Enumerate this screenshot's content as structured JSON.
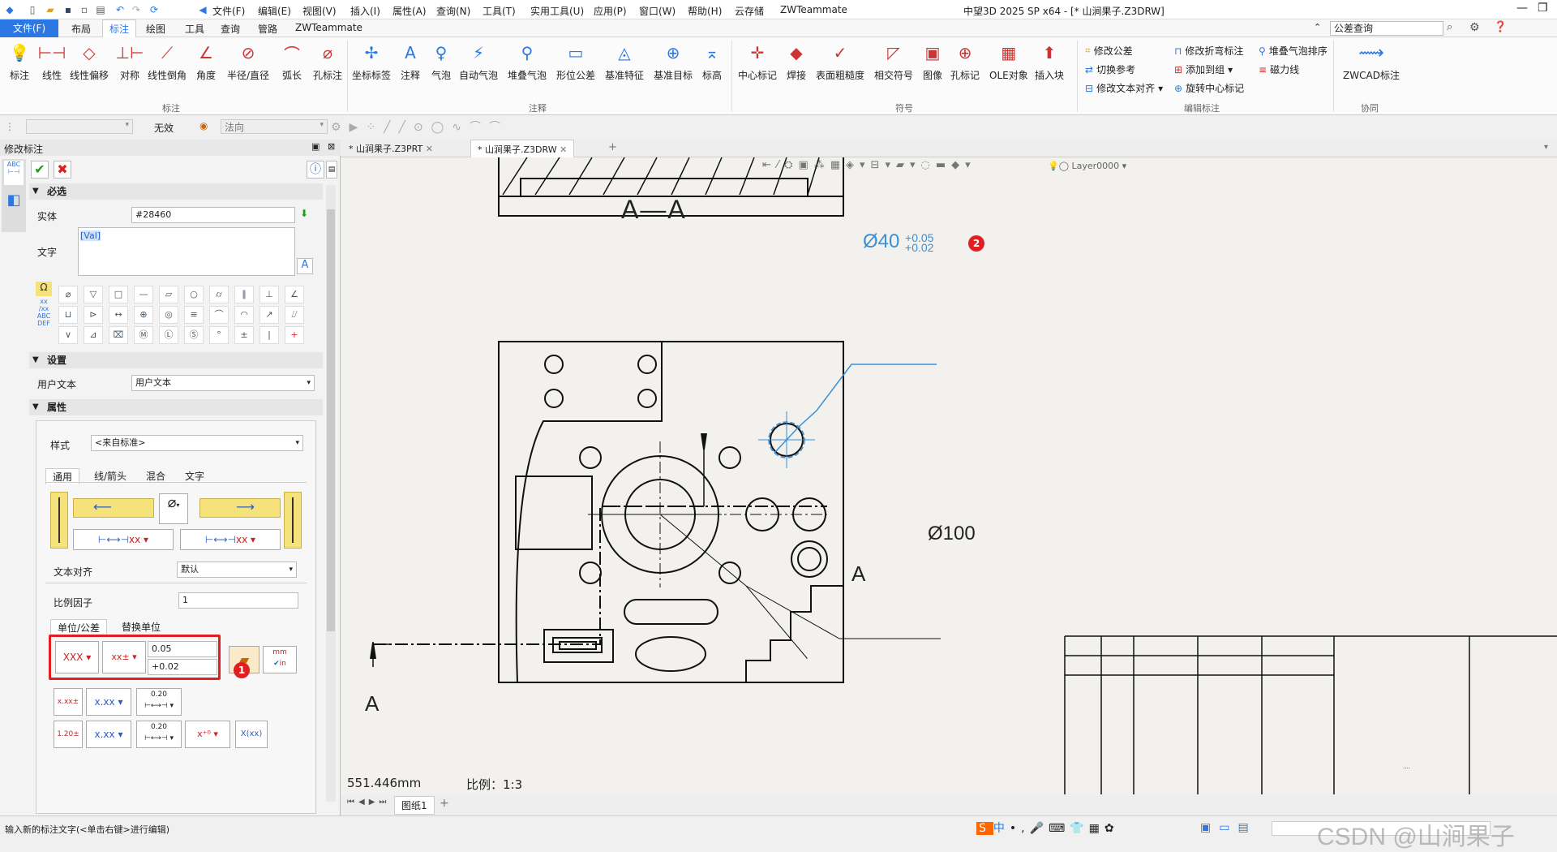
{
  "titlebar": {
    "title": "中望3D 2025 SP x64 - [* 山涧果子.Z3DRW]",
    "menus": [
      "文件(F)",
      "编辑(E)",
      "视图(V)",
      "插入(I)",
      "属性(A)",
      "查询(N)",
      "工具(T)",
      "实用工具(U)",
      "应用(P)",
      "窗口(W)",
      "帮助(H)",
      "云存储",
      "ZWTeammate"
    ]
  },
  "search": {
    "value": "公差查询"
  },
  "ribbon": {
    "tabs": [
      "文件(F)",
      "布局",
      "标注",
      "绘图",
      "工具",
      "查询",
      "管路",
      "ZWTeammate"
    ],
    "group1": {
      "buttons": [
        "标注",
        "线性",
        "线性偏移",
        "对称",
        "线性倒角",
        "角度",
        "半径/直径",
        "弧长",
        "孔标注"
      ],
      "name": "标注"
    },
    "group2": {
      "buttons": [
        "坐标标签",
        "注释",
        "气泡",
        "自动气泡",
        "堆叠气泡",
        "形位公差",
        "基准特征",
        "基准目标",
        "标高"
      ],
      "name": "注释"
    },
    "group3": {
      "buttons": [
        "中心标记",
        "焊接",
        "表面粗糙度",
        "相交符号",
        "图像",
        "孔标记",
        "OLE对象",
        "插入块"
      ],
      "name": "符号"
    },
    "group4": {
      "items": [
        "修改公差",
        "切换参考",
        "修改文本对齐",
        "修改折弯标注",
        "添加到组",
        "旋转中心标记",
        "堆叠气泡排序",
        "磁力线"
      ],
      "name": "编辑标注"
    },
    "group5": {
      "buttons": [
        "ZWCAD标注"
      ],
      "name": "协同"
    }
  },
  "toolbar2": {
    "invalid": "无效",
    "normal": "法向"
  },
  "panel": {
    "title": "修改标注",
    "required": "必选",
    "entity_label": "实体",
    "entity_value": "#28460",
    "text_label": "文字",
    "text_value": "[Val]",
    "settings": "设置",
    "user_text_label": "用户文本",
    "user_text_value": "用户文本",
    "props": "属性",
    "style_label": "样式",
    "style_value": "<来自标准>",
    "subtabs": [
      "通用",
      "线/箭头",
      "混合",
      "文字"
    ],
    "align_label": "文本对齐",
    "align_value": "默认",
    "scale_label": "比例因子",
    "scale_value": "1",
    "unit_tabs": [
      "单位/公差",
      "替换单位"
    ],
    "tol_upper": "0.05",
    "tol_lower": "+0.02",
    "xxx": "XXX",
    "xx_pm": "xx±",
    "xdotxx": "x.xx",
    "upper_sample": "0.20",
    "badge1": "1"
  },
  "doctabs": [
    "* 山涧果子.Z3PRT",
    "* 山涧果子.Z3DRW"
  ],
  "layer": "Layer0000",
  "drawing": {
    "section": "A—A",
    "dim_top_base": "Ø40",
    "dim_top_upper": "+0.05",
    "dim_top_lower": "+0.02",
    "dim_big": "Ø100",
    "label_a": "A",
    "badge2": "2",
    "length": "551.446mm",
    "scale": "比例：1:3"
  },
  "sheet": {
    "name": "图纸1"
  },
  "status": {
    "message": "输入新的标注文字(<单击右键>进行编辑)",
    "watermark": "CSDN @山涧果子"
  },
  "colors": {
    "accent": "#2b78e4",
    "dim": "#3a8fd6",
    "red": "#e02020",
    "ribbon": "#fbfbfb"
  }
}
